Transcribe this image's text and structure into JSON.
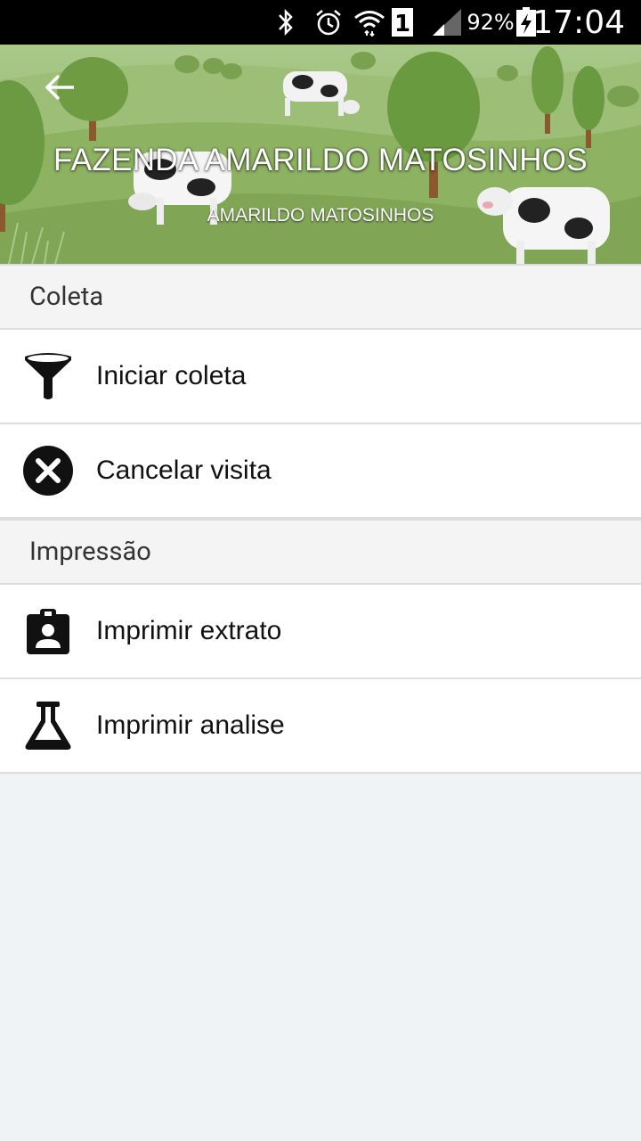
{
  "status_bar": {
    "battery_percent": "92%",
    "time": "17:04",
    "icons": [
      "bluetooth-icon",
      "alarm-icon",
      "wifi-icon",
      "sim-1-icon",
      "signal-icon",
      "battery-charging-icon"
    ]
  },
  "header": {
    "title": "FAZENDA AMARILDO MATOSINHOS",
    "subtitle": "AMARILDO MATOSINHOS",
    "back_icon": "arrow-left-icon"
  },
  "sections": [
    {
      "title": "Coleta",
      "items": [
        {
          "label": "Iniciar coleta",
          "icon": "funnel-icon"
        },
        {
          "label": "Cancelar visita",
          "icon": "cancel-circle-icon"
        }
      ]
    },
    {
      "title": "Impressão",
      "items": [
        {
          "label": "Imprimir extrato",
          "icon": "clipboard-account-icon"
        },
        {
          "label": "Imprimir analise",
          "icon": "flask-icon"
        }
      ]
    }
  ],
  "colors": {
    "status_bar_bg": "#000000",
    "list_bg": "#ffffff",
    "section_bg": "#f4f4f4",
    "page_bg": "#f0f3f6"
  }
}
